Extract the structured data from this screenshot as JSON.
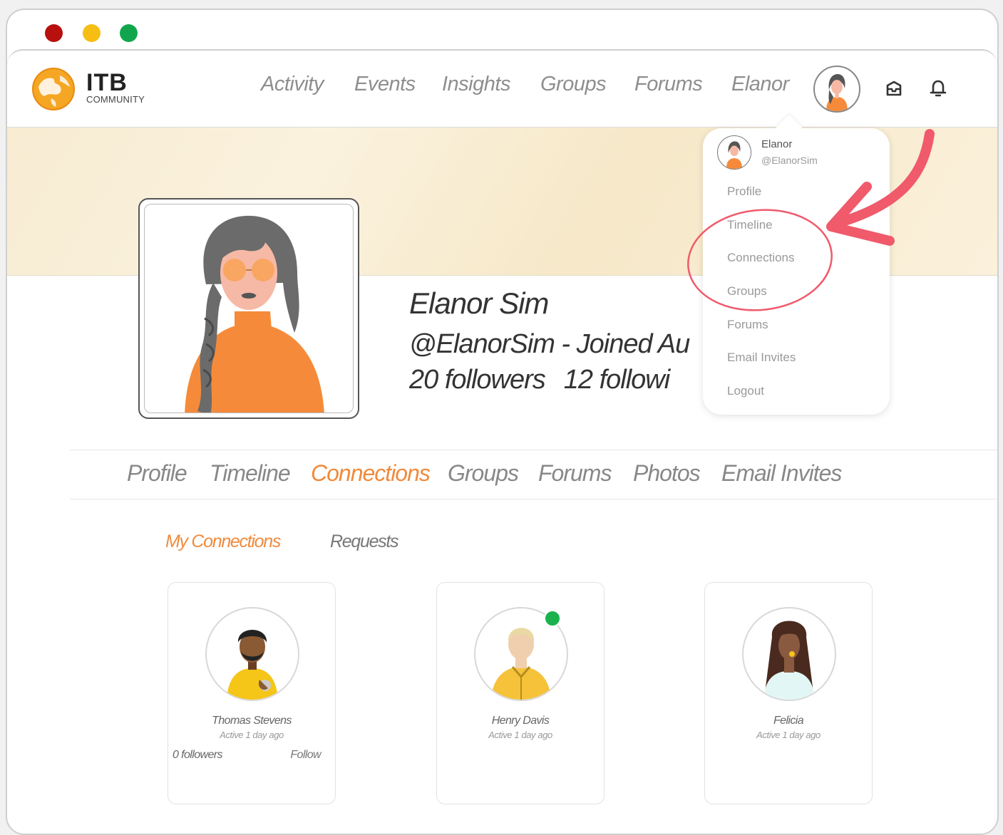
{
  "window": {
    "controls": [
      "close",
      "minimize",
      "maximize"
    ]
  },
  "brand": {
    "name": "ITB",
    "subtitle": "COMMUNITY",
    "logo_icon": "globe-logo"
  },
  "nav": {
    "items": [
      "Activity",
      "Events",
      "Insights",
      "Groups",
      "Forums",
      "Elanor"
    ],
    "icons": [
      "inbox-icon",
      "bell-icon"
    ]
  },
  "profile": {
    "name": "Elanor Sim",
    "handle_line": "@ElanorSim  -  Joined Au",
    "followers": "20 followers",
    "following": "12 followi"
  },
  "dropdown": {
    "name": "Elanor",
    "handle": "@ElanorSim",
    "items": [
      "Profile",
      "Timeline",
      "Connections",
      "Groups",
      "Forums",
      "Email Invites",
      "Logout"
    ]
  },
  "tabs": {
    "items": [
      "Profile",
      "Timeline",
      "Connections",
      "Groups",
      "Forums",
      "Photos",
      "Email Invites"
    ],
    "active": "Connections"
  },
  "subtabs": {
    "items": [
      "My Connections",
      "Requests"
    ],
    "active": "My Connections"
  },
  "connections": [
    {
      "name": "Thomas Stevens",
      "active": "Active 1 day ago",
      "followers": "0 followers",
      "follow": "Follow",
      "online": false
    },
    {
      "name": "Henry Davis",
      "active": "Active 1 day ago",
      "online": true
    },
    {
      "name": "Felicia",
      "active": "Active 1 day ago",
      "online": false
    }
  ],
  "colors": {
    "accent": "#f08a3c",
    "annotation": "#f05a6b",
    "online": "#1bb24e"
  }
}
